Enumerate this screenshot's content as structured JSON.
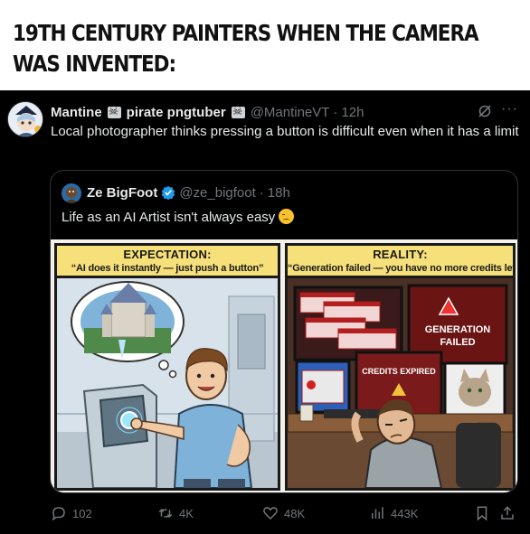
{
  "caption": {
    "text": "19TH CENTURY PAINTERS WHEN THE CAMERA WAS INVENTED:"
  },
  "tweet": {
    "author_name": "Mantine",
    "author_name_suffix": "pirate pngtuber",
    "handle": "@MantineVT",
    "separator": "·",
    "time": "12h",
    "text": "Local photographer thinks pressing a button is difficult even when it has a limit",
    "grok_icon": "grok-icon",
    "more_icon": "more-dots-icon"
  },
  "quote": {
    "author_name": "Ze BigFoot",
    "verified_icon": "verified-badge-icon",
    "handle": "@ze_bigfoot",
    "separator": "·",
    "time": "18h",
    "text": "Life as an AI Artist isn't always easy",
    "emoji": "pensive-face-emoji"
  },
  "comic": {
    "left": {
      "title": "EXPECTATION:",
      "subtitle": "“AI does it instantly — just push a button”"
    },
    "right": {
      "title": "REALITY:",
      "subtitle": "“Generation failed — you have no more credits left”",
      "screen_error": "GENERATION FAILED",
      "screen_credits": "CREDITS EXPIRED"
    }
  },
  "actions": {
    "replies": "102",
    "reposts": "4K",
    "likes": "48K",
    "views": "443K"
  },
  "colors": {
    "background": "#000000",
    "text_primary": "#e7e9ea",
    "text_secondary": "#71767b",
    "verified_blue": "#1d9bf0",
    "banner_yellow": "#f6e07a"
  }
}
